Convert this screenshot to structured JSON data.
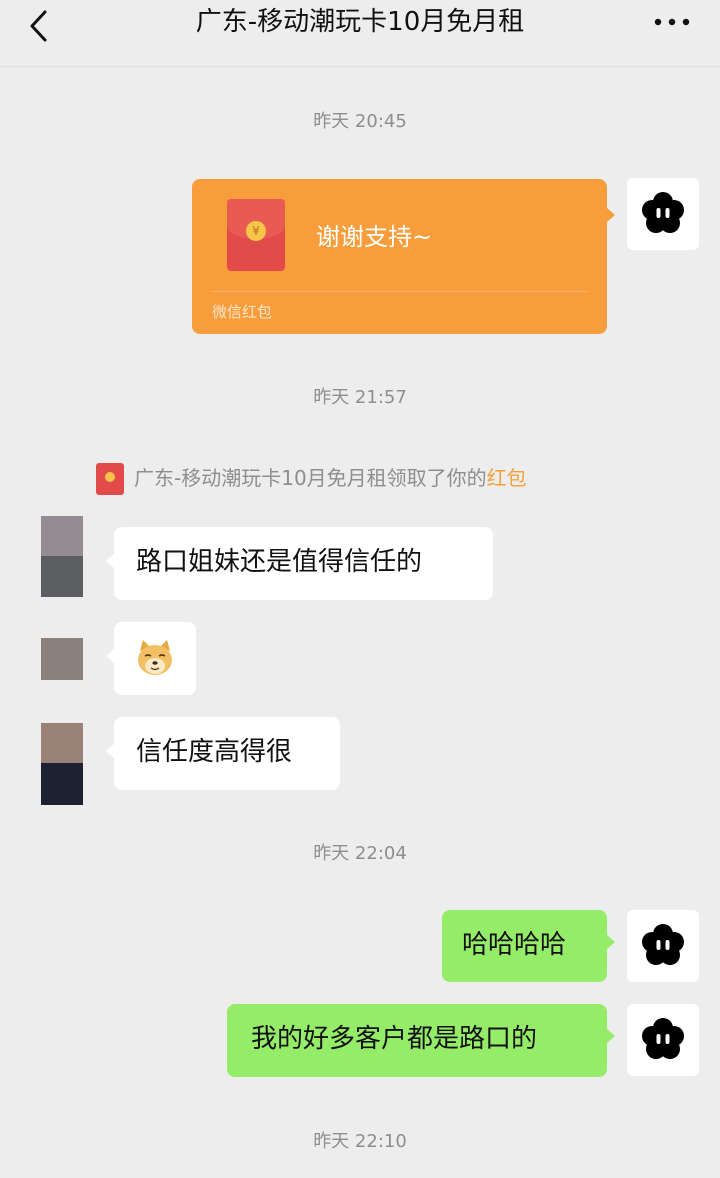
{
  "header": {
    "title": "广东-移动潮玩卡10月免月租",
    "back_icon": "chevron-left-icon",
    "more_icon": "more-dots-icon"
  },
  "timestamps": [
    "昨天 20:45",
    "昨天 21:57",
    "昨天 22:04",
    "昨天 22:10"
  ],
  "red_packet": {
    "message": "谢谢支持~",
    "footer": "微信红包",
    "color": "#f79d3b"
  },
  "system_note": {
    "prefix": "广东-移动潮玩卡10月免月租领取了你的",
    "highlight": "红包"
  },
  "messages": [
    {
      "side": "left",
      "text": "路口姐妹还是值得信任的"
    },
    {
      "side": "left",
      "emoji": "doge-emoji-icon"
    },
    {
      "side": "left",
      "text": "信任度高得很"
    },
    {
      "side": "right",
      "text": "哈哈哈哈"
    },
    {
      "side": "right",
      "text": "我的好多客户都是路口的"
    }
  ],
  "colors": {
    "background": "#ededed",
    "green_bubble": "#95ec69",
    "white_bubble": "#ffffff",
    "accent": "#f0a33a"
  }
}
